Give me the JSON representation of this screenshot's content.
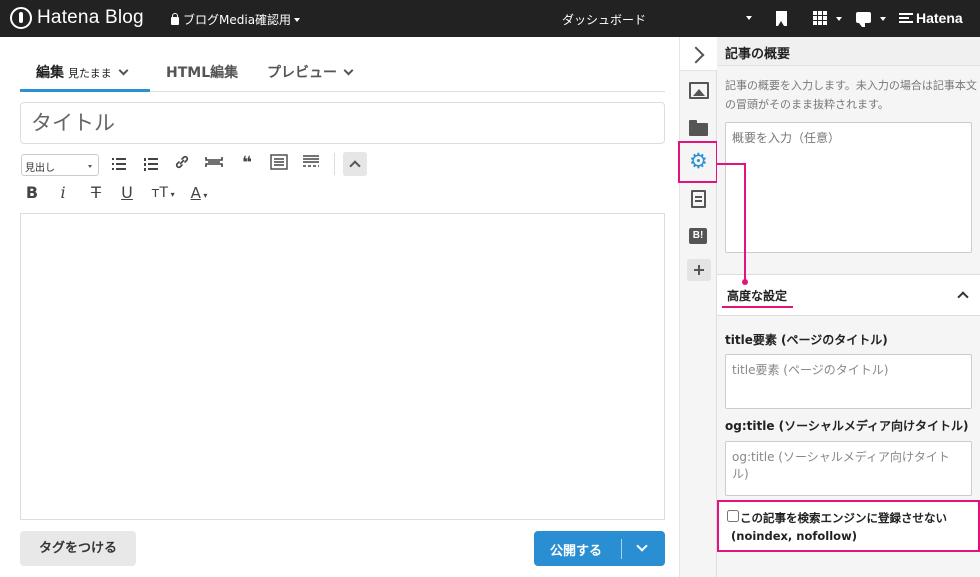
{
  "topbar": {
    "logo_text": "Hatena Blog",
    "blog_name": "ブログMedia確認用",
    "dashboard_label": "ダッシュボード",
    "brand": "Hatena"
  },
  "editor": {
    "tabs": [
      {
        "label": "編集",
        "sub": "見たまま"
      },
      {
        "label": "HTML編集",
        "sub": ""
      },
      {
        "label": "プレビュー",
        "sub": ""
      }
    ],
    "title_placeholder": "タイトル",
    "format_select_value": "見出し",
    "toolbar_glyphs": {
      "bold": "B",
      "italic": "i",
      "strike": "T",
      "underline": "U",
      "font_size": "тT",
      "color": "A",
      "quote": "❝"
    },
    "tag_button": "タグをつける",
    "publish_button": "公開する"
  },
  "panel": {
    "summary_title": "記事の概要",
    "summary_desc": "記事の概要を入力します。未入力の場合は記事本文の冒頭がそのまま抜粋されます。",
    "summary_placeholder": "概要を入力（任意）",
    "advanced_title": "高度な設定",
    "title_field_label": "title要素 (ページのタイトル)",
    "title_field_placeholder": "title要素 (ページのタイトル)",
    "og_field_label": "og:title (ソーシャルメディア向けタイトル)",
    "og_field_placeholder": "og:title (ソーシャルメディア向けタイトル)",
    "noindex_line1": "この記事を検索エンジンに登録させない",
    "noindex_line2": "(noindex, nofollow)"
  },
  "rail": {
    "hatebu_label": "B!"
  },
  "colors": {
    "accent_blue": "#2a8ed3",
    "highlight_pink": "#e4127e",
    "topbar": "#222222"
  }
}
